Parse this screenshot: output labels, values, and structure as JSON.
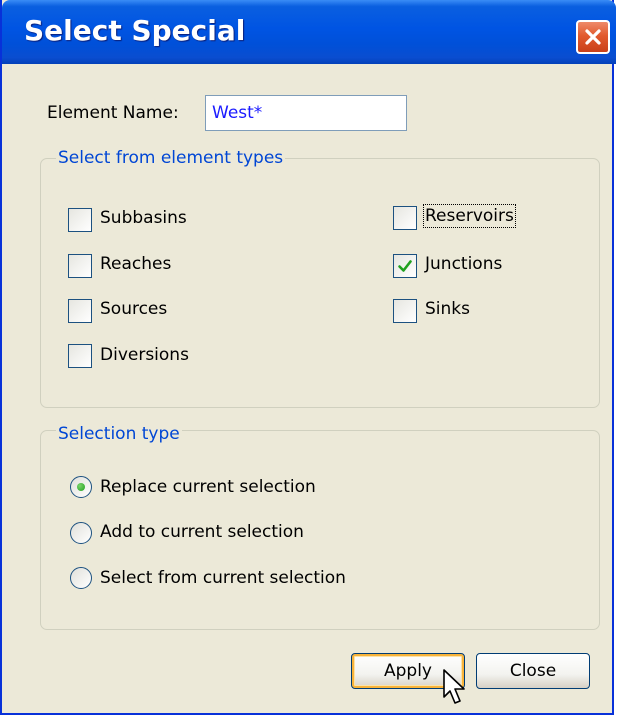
{
  "window": {
    "title": "Select Special",
    "close_icon": "close-icon",
    "titlebar_color": "#0054e3",
    "close_color": "#e25a2e"
  },
  "element_name": {
    "label": "Element Name:",
    "value": "West*",
    "value_color": "#1b1bff"
  },
  "element_types": {
    "title": "Select from element types",
    "items": [
      {
        "label": "Subbasins",
        "checked": false
      },
      {
        "label": "Reaches",
        "checked": false
      },
      {
        "label": "Sources",
        "checked": false
      },
      {
        "label": "Diversions",
        "checked": false
      },
      {
        "label": "Reservoirs",
        "checked": false,
        "focused": true
      },
      {
        "label": "Junctions",
        "checked": true
      },
      {
        "label": "Sinks",
        "checked": false
      }
    ]
  },
  "selection_type": {
    "title": "Selection type",
    "options": [
      {
        "label": "Replace current selection",
        "selected": true
      },
      {
        "label": "Add to current selection",
        "selected": false
      },
      {
        "label": "Select from current selection",
        "selected": false
      }
    ]
  },
  "buttons": {
    "apply": "Apply",
    "close": "Close"
  },
  "colors": {
    "group_title": "#0046d5",
    "window_bg": "#ece9d8",
    "check_mark": "#21a121"
  }
}
